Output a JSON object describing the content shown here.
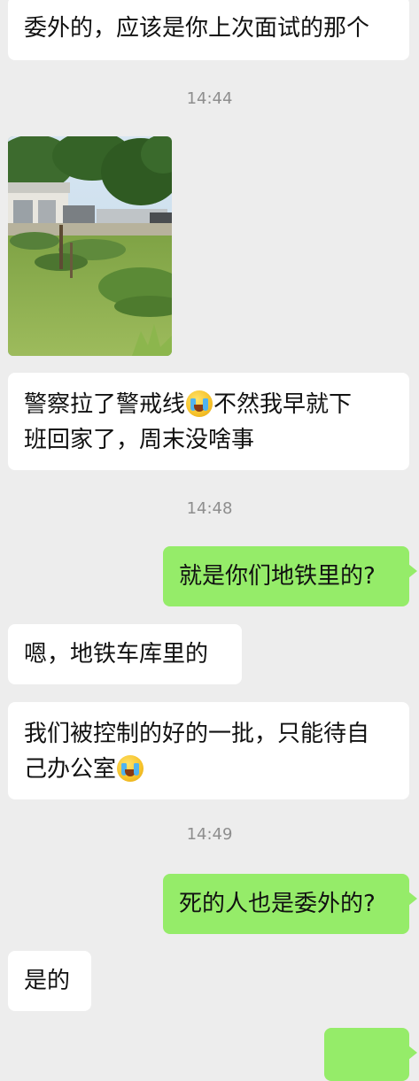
{
  "messages": [
    {
      "type": "text",
      "side": "left",
      "text": "委外的，应该是你上次面试的那个"
    },
    {
      "type": "time",
      "text": "14:44"
    },
    {
      "type": "image",
      "side": "left"
    },
    {
      "type": "text",
      "side": "left",
      "parts": [
        "警察拉了警戒线",
        "不然我早就下",
        "班回家了，周末没啥事"
      ],
      "emoji": "crying-laughing-emoji"
    },
    {
      "type": "time",
      "text": "14:48"
    },
    {
      "type": "text",
      "side": "right",
      "text": "就是你们地铁里的?"
    },
    {
      "type": "text",
      "side": "left",
      "text": "嗯，地铁车库里的"
    },
    {
      "type": "text",
      "side": "left",
      "parts": [
        "我们被控制的好的一批，只能待自",
        "己办公室"
      ],
      "emoji": "crying-laughing-emoji"
    },
    {
      "type": "time",
      "text": "14:49"
    },
    {
      "type": "text",
      "side": "right",
      "text": "死的人也是委外的?"
    },
    {
      "type": "text",
      "side": "left",
      "text": "是的"
    }
  ],
  "colors": {
    "background": "#ededed",
    "incoming_bubble": "#ffffff",
    "outgoing_bubble": "#95ec69",
    "timestamp_text": "#8e8e8e"
  }
}
